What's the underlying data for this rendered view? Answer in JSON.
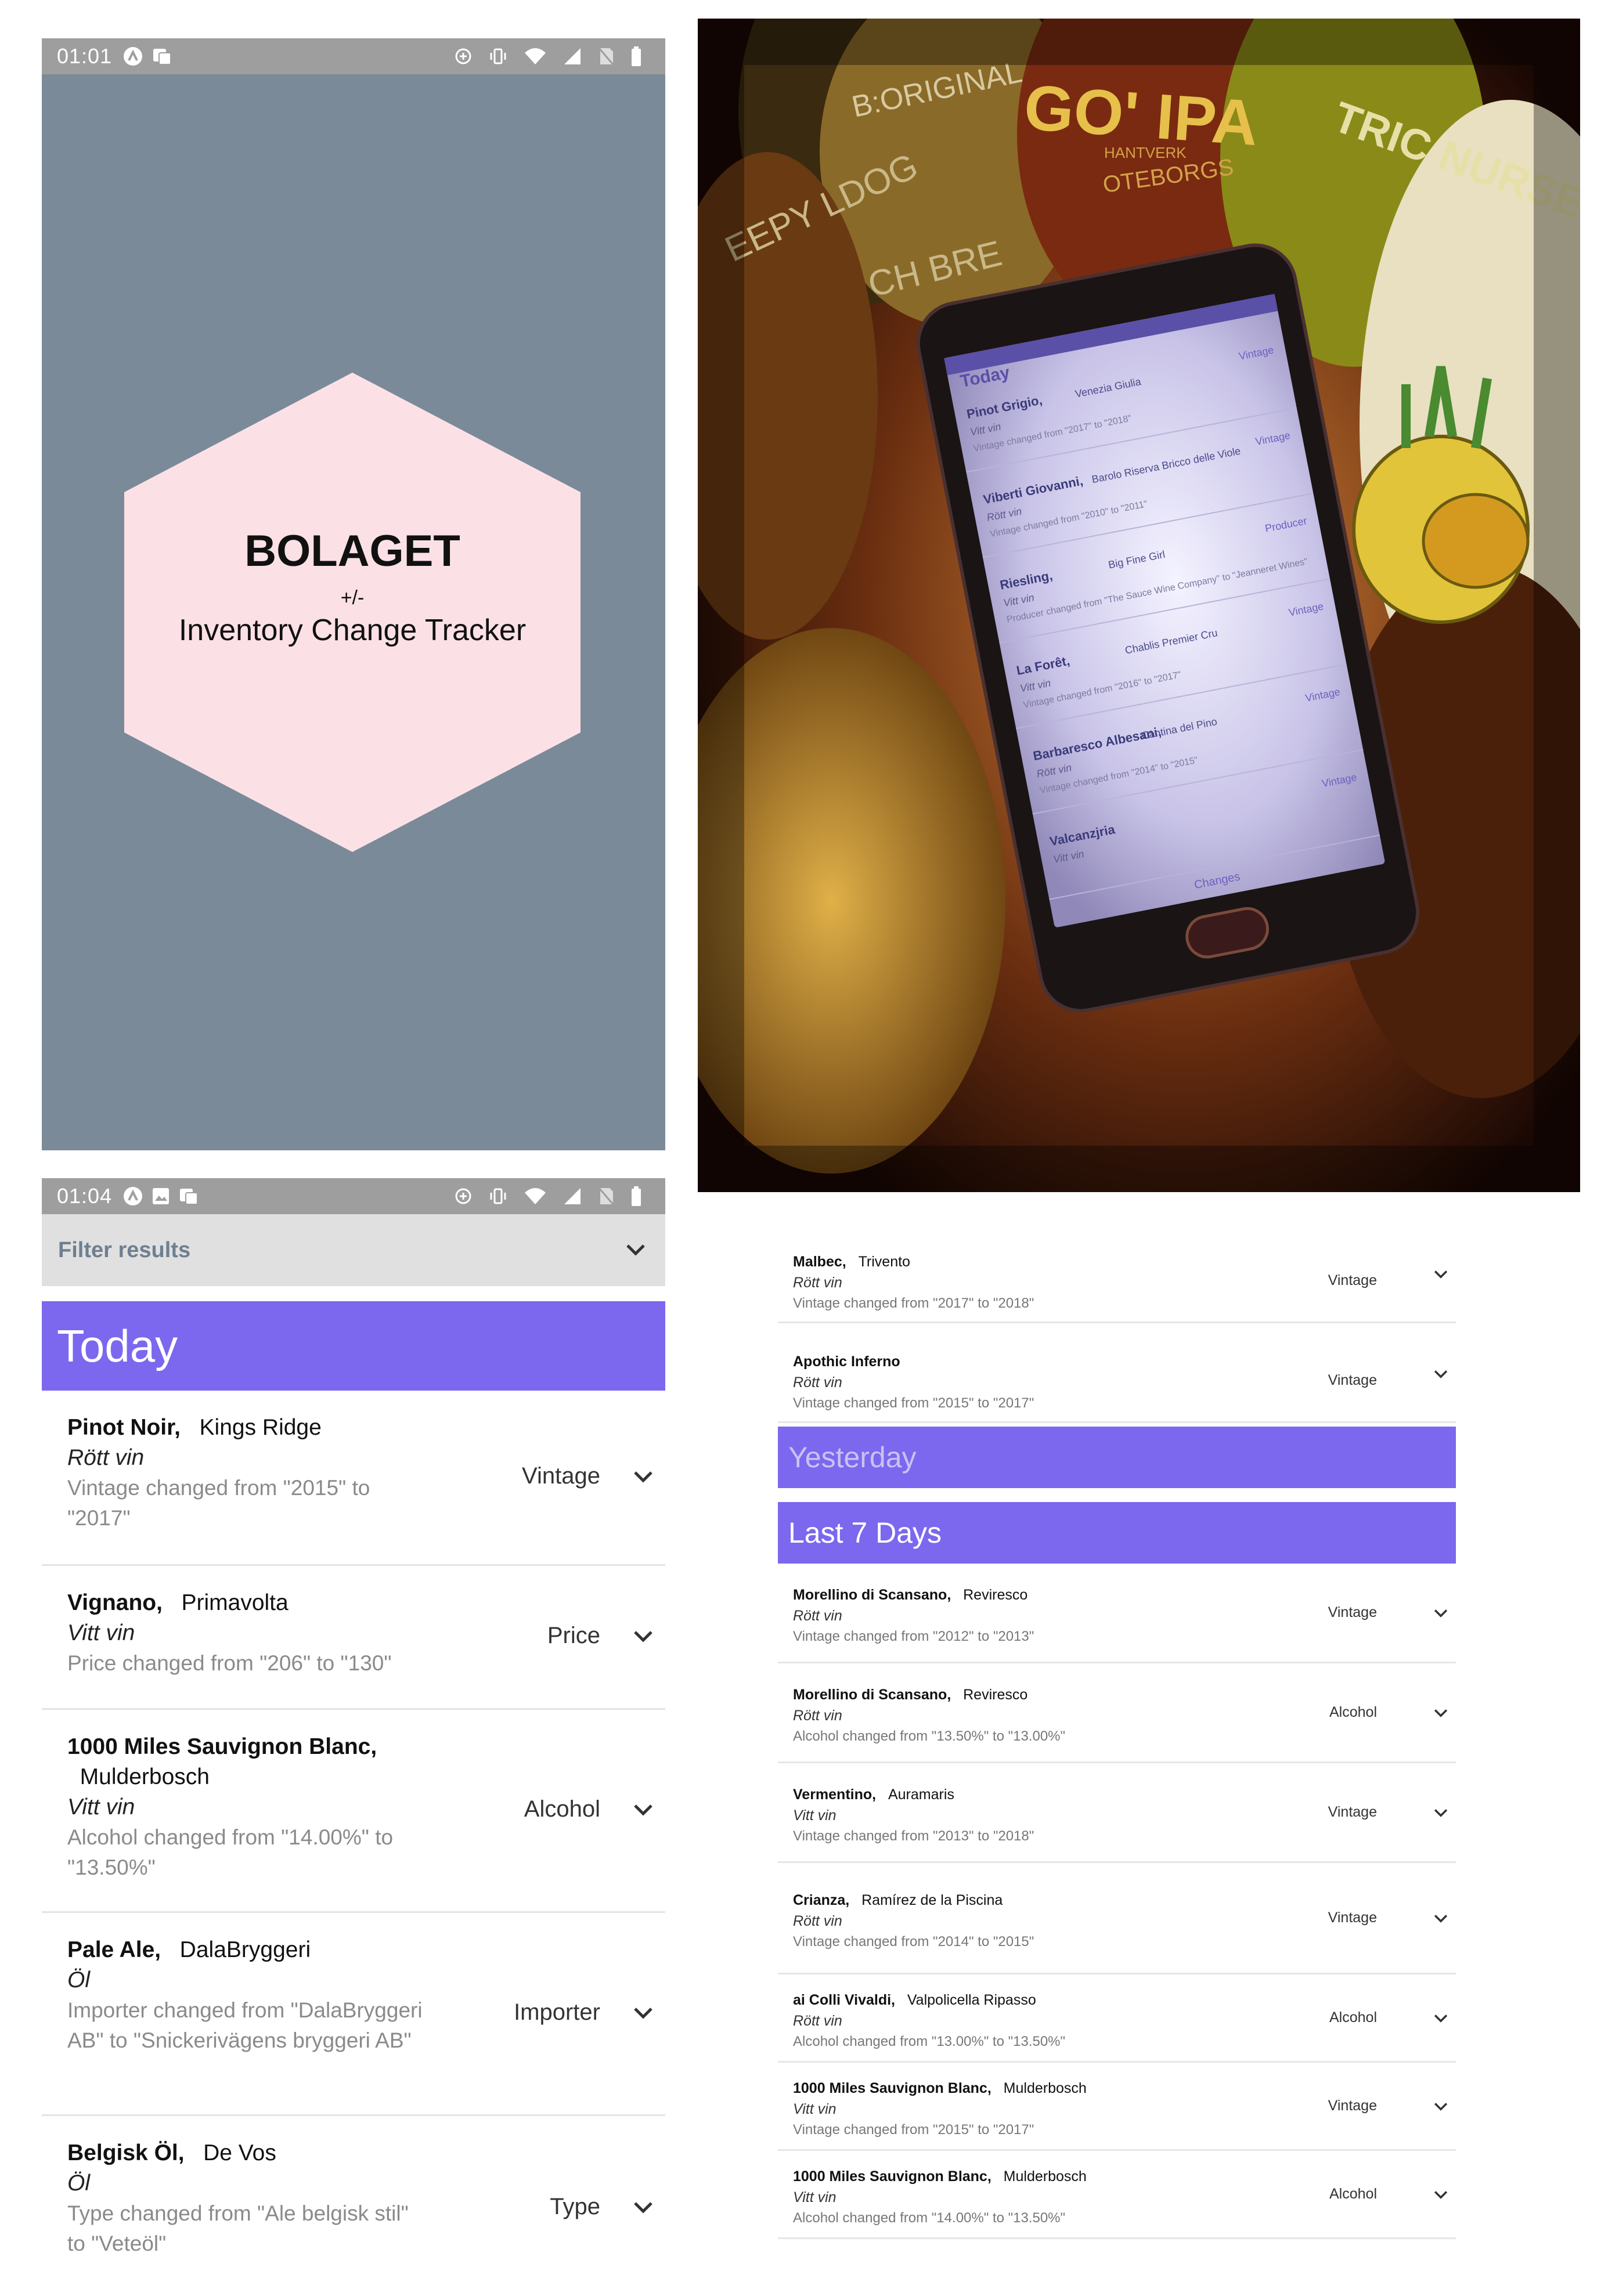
{
  "splash": {
    "status_time": "01:01",
    "title": "BOLAGET",
    "plusminus": "+/-",
    "subtitle": "Inventory Change Tracker",
    "colors": {
      "background": "#7a8a99",
      "hexagon": "#fbe1e6",
      "statusbar": "#9e9e9e"
    }
  },
  "photo": {
    "label_marks": [
      "B:ORIGINAL",
      "GO' IPA",
      "EEPY LDOG",
      "CH BRE",
      "OTEBORGS",
      "TRIC NURSE",
      "HANTVERK"
    ],
    "phone_header": "Today",
    "phone_rows": [
      {
        "name": "Pinot Grigio,",
        "producer": "Venezia Giulia",
        "type": "Vitt vin",
        "desc": "Vintage changed from \"2017\" to \"2018\"",
        "kind": "Vintage"
      },
      {
        "name": "Viberti Giovanni,",
        "producer": "Barolo Riserva Bricco delle Viole",
        "type": "Rött vin",
        "desc": "Vintage changed from \"2010\" to \"2011\"",
        "kind": "Vintage"
      },
      {
        "name": "Riesling,",
        "producer": "Big Fine Girl",
        "type": "Vitt vin",
        "desc": "Producer changed from \"The Sauce Wine Company\" to \"Jeanneret Wines\"",
        "kind": "Producer"
      },
      {
        "name": "La Forêt,",
        "producer": "Chablis Premier Cru",
        "type": "Vitt vin",
        "desc": "Vintage changed from \"2016\" to \"2017\"",
        "kind": "Vintage"
      },
      {
        "name": "Barbaresco Albesani,",
        "producer": "Cantina del Pino",
        "type": "Rött vin",
        "desc": "Vintage changed from \"2014\" to \"2015\"",
        "kind": "Vintage"
      },
      {
        "name": "Valcanzjria",
        "producer": "",
        "type": "Vitt vin",
        "desc": "",
        "kind": "Vintage"
      }
    ],
    "phone_tab": "Changes"
  },
  "left_list": {
    "status_time": "01:04",
    "filter_label": "Filter results",
    "section_today": "Today",
    "accent": "#7b68ee",
    "items": [
      {
        "name": "Pinot Noir,",
        "producer": "Kings Ridge",
        "type": "Rött vin",
        "desc": "Vintage changed from \"2015\" to \"2017\"",
        "kind": "Vintage"
      },
      {
        "name": "Vignano,",
        "producer": "Primavolta",
        "type": "Vitt vin",
        "desc": "Price changed from \"206\" to \"130\"",
        "kind": "Price"
      },
      {
        "name": "1000 Miles Sauvignon Blanc,",
        "producer": "Mulderbosch",
        "type": "Vitt vin",
        "desc": "Alcohol changed from \"14.00%\" to \"13.50%\"",
        "kind": "Alcohol"
      },
      {
        "name": "Pale Ale,",
        "producer": "DalaBryggeri",
        "type": "Öl",
        "desc": "Importer changed from \"DalaBryggeri AB\" to \"Snickerivägens bryggeri AB\"",
        "kind": "Importer"
      },
      {
        "name": "Belgisk Öl,",
        "producer": "De Vos",
        "type": "Öl",
        "desc": "Type changed from \"Ale belgisk stil\" to \"Veteöl\"",
        "kind": "Type"
      }
    ]
  },
  "right_list": {
    "top_items": [
      {
        "name": "Malbec,",
        "producer": "Trivento",
        "type": "Rött vin",
        "desc": "Vintage changed from \"2017\" to \"2018\"",
        "kind": "Vintage"
      },
      {
        "name": "Apothic Inferno",
        "producer": "",
        "type": "Rött vin",
        "desc": "Vintage changed from \"2015\" to \"2017\"",
        "kind": "Vintage"
      }
    ],
    "section_yesterday": "Yesterday",
    "section_last7": "Last 7 Days",
    "items": [
      {
        "name": "Morellino di Scansano,",
        "producer": "Reviresco",
        "type": "Rött vin",
        "desc": "Vintage changed from \"2012\" to \"2013\"",
        "kind": "Vintage"
      },
      {
        "name": "Morellino di Scansano,",
        "producer": "Reviresco",
        "type": "Rött vin",
        "desc": "Alcohol changed from \"13.50%\" to \"13.00%\"",
        "kind": "Alcohol"
      },
      {
        "name": "Vermentino,",
        "producer": "Auramaris",
        "type": "Vitt vin",
        "desc": "Vintage changed from \"2013\" to \"2018\"",
        "kind": "Vintage"
      },
      {
        "name": "Crianza,",
        "producer": "Ramírez de la Piscina",
        "type": "Rött vin",
        "desc": "Vintage changed from \"2014\" to \"2015\"",
        "kind": "Vintage"
      },
      {
        "name": "ai Colli Vivaldi,",
        "producer": "Valpolicella Ripasso",
        "type": "Rött vin",
        "desc": "Alcohol changed from \"13.00%\" to \"13.50%\"",
        "kind": "Alcohol"
      },
      {
        "name": "1000 Miles Sauvignon Blanc,",
        "producer": "Mulderbosch",
        "type": "Vitt vin",
        "desc": "Vintage changed from \"2015\" to \"2017\"",
        "kind": "Vintage"
      },
      {
        "name": "1000 Miles Sauvignon Blanc,",
        "producer": "Mulderbosch",
        "type": "Vitt vin",
        "desc": "Alcohol changed from \"14.00%\" to \"13.50%\"",
        "kind": "Alcohol"
      }
    ]
  }
}
